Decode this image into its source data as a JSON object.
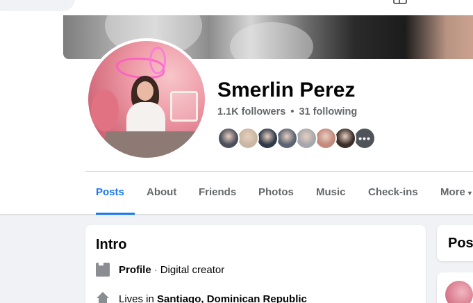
{
  "profile": {
    "name": "Smerlin Perez",
    "followers": "1.1K followers",
    "separator": "•",
    "following": "31 following",
    "friend_avatars": [
      {
        "color": "#4b4f5c"
      },
      {
        "color": "#c9b7a3"
      },
      {
        "color": "#2f3b4a"
      },
      {
        "color": "#5a6473"
      },
      {
        "color": "#a5a7ad"
      },
      {
        "color": "#c28a7d"
      },
      {
        "color": "#3a2e2b"
      },
      {
        "color": "#7b6e66"
      }
    ],
    "more_friends_glyph": "•••",
    "more_friends_color": "#50545a"
  },
  "tabs": [
    {
      "label": "Posts",
      "active": true
    },
    {
      "label": "About",
      "active": false
    },
    {
      "label": "Friends",
      "active": false
    },
    {
      "label": "Photos",
      "active": false
    },
    {
      "label": "Music",
      "active": false
    },
    {
      "label": "Check-ins",
      "active": false
    },
    {
      "label": "More",
      "active": false,
      "icon": "caret-down-icon"
    }
  ],
  "intro": {
    "title": "Intro",
    "rows": [
      {
        "icon": "flag-icon",
        "bold": "Profile",
        "separator": "·",
        "text": "Digital creator"
      },
      {
        "icon": "home-icon",
        "prefix": "Lives in ",
        "bold": "Santiago, Dominican Republic"
      }
    ]
  },
  "posts": {
    "title": "Posts"
  },
  "colors": {
    "accent": "#1877f2",
    "secondary_text": "#65676b",
    "background": "#f0f2f5"
  }
}
